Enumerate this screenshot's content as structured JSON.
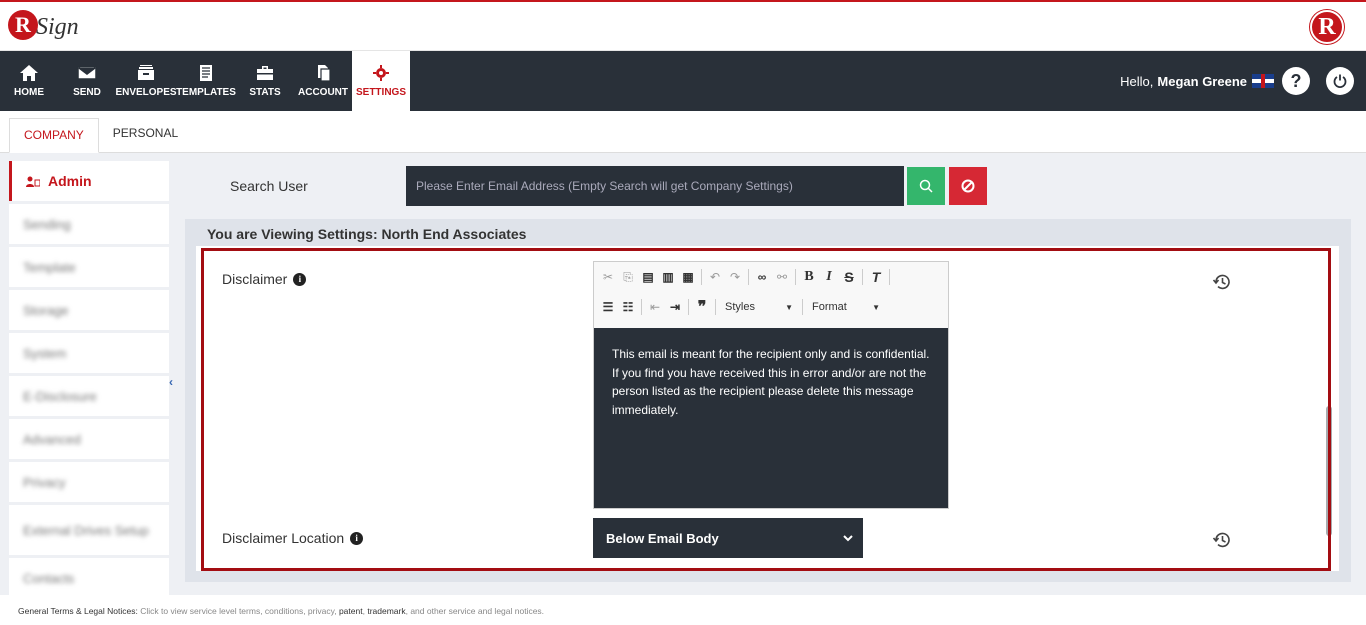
{
  "brand": {
    "logo_letter": "R",
    "logo_text": "Sign"
  },
  "nav": {
    "items": [
      {
        "label": "HOME",
        "icon": "home-icon"
      },
      {
        "label": "SEND",
        "icon": "envelope-icon"
      },
      {
        "label": "ENVELOPES",
        "icon": "envelopes-icon"
      },
      {
        "label": "TEMPLATES",
        "icon": "templates-icon"
      },
      {
        "label": "STATS",
        "icon": "briefcase-icon"
      },
      {
        "label": "ACCOUNT",
        "icon": "account-icon"
      },
      {
        "label": "SETTINGS",
        "icon": "gear-icon"
      }
    ],
    "active": "SETTINGS",
    "greeting": "Hello,",
    "user_name": "Megan Greene",
    "help_icon": "?",
    "power_icon": "power-icon"
  },
  "tabs": [
    {
      "label": "COMPANY"
    },
    {
      "label": "PERSONAL"
    }
  ],
  "sidebar": {
    "items": [
      {
        "label": "Admin"
      },
      {
        "label": "Sending"
      },
      {
        "label": "Template"
      },
      {
        "label": "Storage"
      },
      {
        "label": "System"
      },
      {
        "label": "E-Disclosure"
      },
      {
        "label": "Advanced"
      },
      {
        "label": "Privacy"
      },
      {
        "label": "External Drives Setup"
      },
      {
        "label": "Contacts"
      }
    ]
  },
  "search": {
    "label": "Search User",
    "placeholder": "Please Enter Email Address (Empty Search will get Company Settings)"
  },
  "panel": {
    "title": "You are Viewing Settings: North End Associates",
    "disclaimer_label": "Disclaimer",
    "disclaimer_text": "This email is meant for the recipient only and is confidential. If you find you have received this in error and/or are not the person listed as the recipient please delete this message immediately.",
    "styles_label": "Styles",
    "format_label": "Format",
    "location_label": "Disclaimer Location",
    "location_value": "Below Email Body"
  },
  "footer": {
    "title": "General Terms & Legal Notices:",
    "text_a": "Click to view service level terms, conditions, privacy,",
    "patent": "patent",
    "trademark": "trademark",
    "text_b": ", and other service and legal notices."
  },
  "colors": {
    "brand_red": "#c4161c",
    "navbar": "#293039",
    "search_green": "#34b66c",
    "clear_red": "#d62834"
  }
}
